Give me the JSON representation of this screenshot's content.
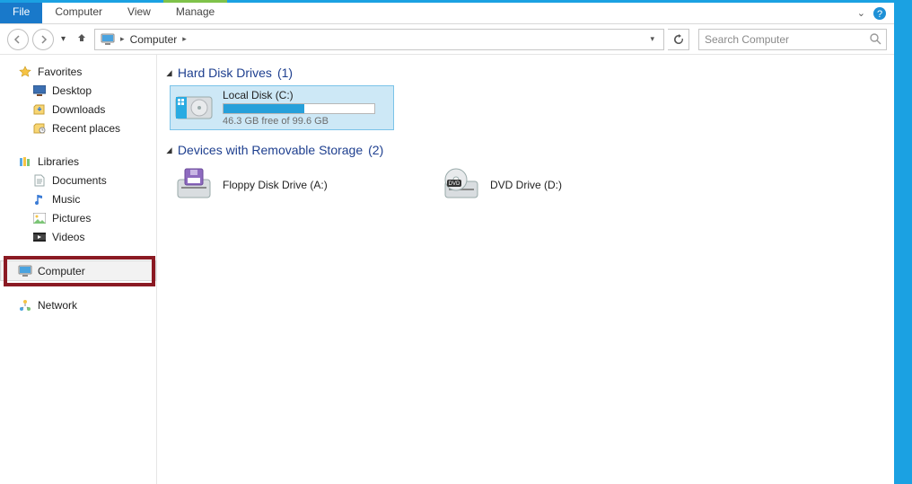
{
  "ribbon": {
    "file": "File",
    "tabs": [
      "Computer",
      "View"
    ],
    "context_tab": "Manage"
  },
  "breadcrumb": {
    "root": "Computer"
  },
  "search": {
    "placeholder": "Search Computer"
  },
  "navpane": {
    "favorites": {
      "label": "Favorites",
      "children": [
        "Desktop",
        "Downloads",
        "Recent places"
      ]
    },
    "libraries": {
      "label": "Libraries",
      "children": [
        "Documents",
        "Music",
        "Pictures",
        "Videos"
      ]
    },
    "computer": {
      "label": "Computer"
    },
    "network": {
      "label": "Network"
    }
  },
  "sections": {
    "hdd": {
      "title": "Hard Disk Drives",
      "count": "(1)",
      "items": [
        {
          "name": "Local Disk (C:)",
          "free_text": "46.3 GB free of 99.6 GB",
          "used_pct": 53.5
        }
      ]
    },
    "removable": {
      "title": "Devices with Removable Storage",
      "count": "(2)",
      "items": [
        {
          "name": "Floppy Disk Drive (A:)"
        },
        {
          "name": "DVD Drive (D:)"
        }
      ]
    }
  }
}
